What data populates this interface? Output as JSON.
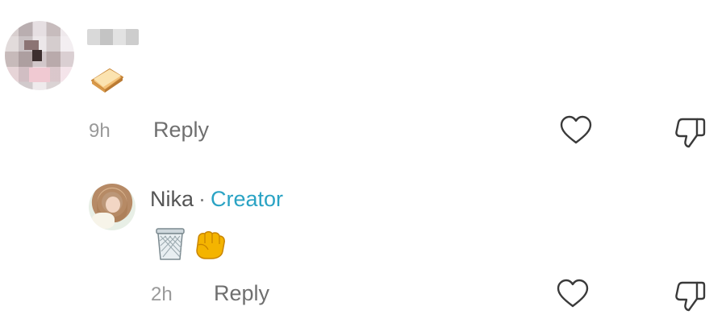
{
  "comments": [
    {
      "author_name_blurred": true,
      "text_emoji": [
        "sandwich"
      ],
      "time": "9h",
      "reply_label": "Reply"
    },
    {
      "author_name": "Nika",
      "separator": "·",
      "badge": "Creator",
      "text_emoji": [
        "wastebasket",
        "raised-fist"
      ],
      "time": "2h",
      "reply_label": "Reply"
    }
  ],
  "icons": {
    "like": "heart-outline-icon",
    "dislike": "thumbs-down-outline-icon"
  },
  "colors": {
    "creator_badge": "#2aa3c4",
    "meta_text": "#9a9a9a",
    "reply_text": "#6f6f6f"
  }
}
